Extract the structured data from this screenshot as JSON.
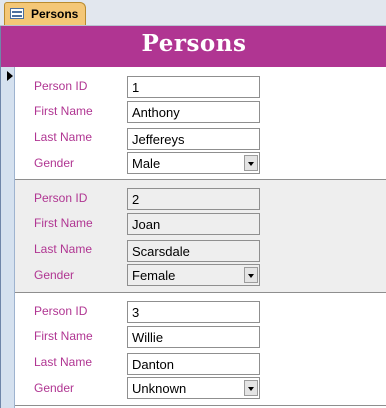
{
  "tab": {
    "title": "Persons",
    "icon": "form-icon"
  },
  "header": {
    "title": "Persons"
  },
  "labels": {
    "person_id": "Person ID",
    "first_name": "First Name",
    "last_name": "Last Name",
    "gender": "Gender"
  },
  "records": [
    {
      "person_id": "1",
      "first_name": "Anthony",
      "last_name": "Jeffereys",
      "gender": "Male"
    },
    {
      "person_id": "2",
      "first_name": "Joan",
      "last_name": "Scarsdale",
      "gender": "Female"
    },
    {
      "person_id": "3",
      "first_name": "Willie",
      "last_name": "Danton",
      "gender": "Unknown"
    }
  ],
  "colors": {
    "header_bg": "#b03592",
    "label_text": "#b03592",
    "tab_bg": "#f4c777",
    "alt_row_bg": "#eeeeee"
  }
}
